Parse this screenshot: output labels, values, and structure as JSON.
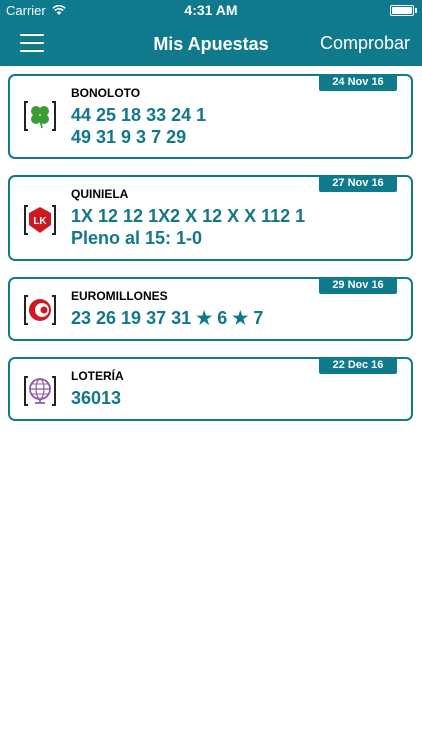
{
  "status_bar": {
    "carrier": "Carrier",
    "time": "4:31 AM",
    "battery_level": 1.0
  },
  "nav": {
    "title": "Mis Apuestas",
    "right_action": "Comprobar",
    "left_icon": "hamburger-menu-icon"
  },
  "colors": {
    "primary": "#0e7a8c",
    "number_text": "#13778a",
    "card_border": "#15788a"
  },
  "bets": [
    {
      "game": "BONOLOTO",
      "date": "24 Nov 16",
      "lines": [
        "44 25 18 33 24 1",
        "49 31 9 3 7 29"
      ],
      "icon": "clover-icon"
    },
    {
      "game": "QUINIELA",
      "date": "27 Nov 16",
      "lines": [
        "1X 12 12 1X2 X 12 X X 112 1",
        "Pleno al 15: 1-0"
      ],
      "icon": "quiniela-icon"
    },
    {
      "game": "EUROMILLONES",
      "date": "29 Nov 16",
      "lines": [
        "23 26 19 37 31 ★ 6 ★ 7"
      ],
      "icon": "euromillones-icon"
    },
    {
      "game": "LOTERÍA",
      "date": "22 Dec 16",
      "lines": [
        "36013"
      ],
      "icon": "loteria-globe-icon"
    }
  ]
}
